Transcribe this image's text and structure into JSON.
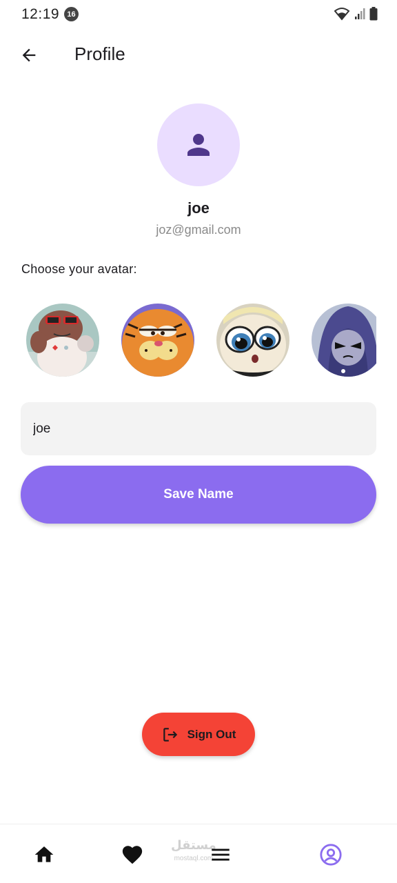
{
  "status_bar": {
    "time": "12:19",
    "notification_count": "16"
  },
  "app_bar": {
    "title": "Profile"
  },
  "profile": {
    "name": "joe",
    "email": "joz@gmail.com"
  },
  "avatar_section": {
    "label": "Choose your avatar:",
    "avatars": [
      {
        "name": "bear-avatar"
      },
      {
        "name": "garfield-avatar"
      },
      {
        "name": "powerpuff-avatar"
      },
      {
        "name": "raven-avatar"
      }
    ]
  },
  "name_field": {
    "value": "joe"
  },
  "save_button": {
    "label": "Save Name"
  },
  "sign_out_button": {
    "label": "Sign Out",
    "icon": "logout-icon"
  },
  "bottom_nav": {
    "items": [
      {
        "icon": "home-icon"
      },
      {
        "icon": "heart-icon"
      },
      {
        "icon": "menu-icon"
      },
      {
        "icon": "account-circle-icon",
        "active": true
      }
    ],
    "watermark": {
      "text": "مستقل",
      "sub": "mostaql.com"
    }
  },
  "colors": {
    "accent": "#8b6cef",
    "avatar_bg": "#eaddff",
    "avatar_icon": "#4f378b",
    "danger": "#f44336",
    "nav_active": "#8b6cef"
  }
}
